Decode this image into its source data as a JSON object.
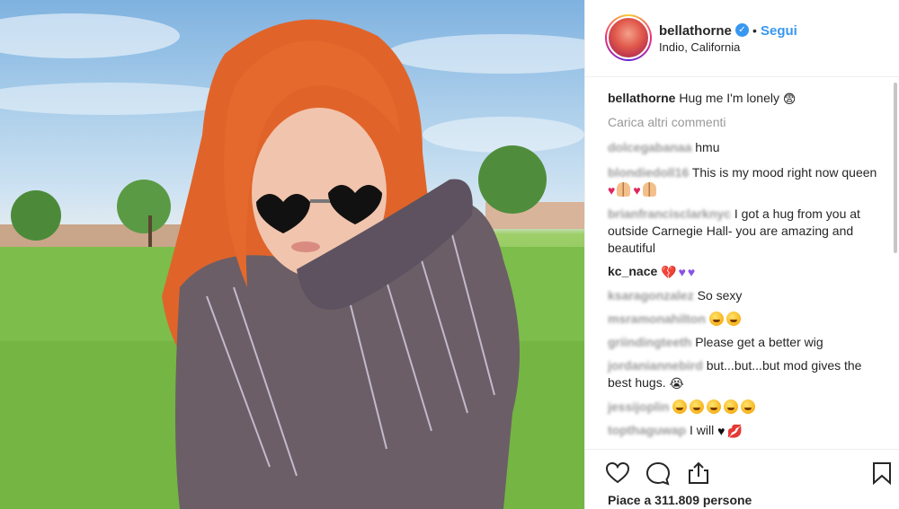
{
  "post": {
    "username": "bellathorne",
    "follow_label": "Segui",
    "separator": "•",
    "location": "Indio, California",
    "caption": "Hug me I'm lonely",
    "load_more": "Carica altri commenti",
    "likes_text": "Piace a 311.809 persone"
  },
  "comments": [
    {
      "user": "dolcegabanaa",
      "text": "hmu",
      "emojis": []
    },
    {
      "user": "blondiedoll16",
      "text": "This is my mood right now queen",
      "emojis": [
        "red-heart",
        "pray",
        "red-heart",
        "pray"
      ]
    },
    {
      "user": "brianfrancisclarknyc",
      "text": "I got a hug from you at outside Carnegie Hall- you are amazing and beautiful",
      "emojis": []
    },
    {
      "user": "kc_nace",
      "text": "",
      "emojis": [
        "broken-heart",
        "purple-heart",
        "purple-heart"
      ]
    },
    {
      "user": "ksaragonzalez",
      "text": "So sexy",
      "emojis": []
    },
    {
      "user": "msramonahilton",
      "text": "",
      "emojis": [
        "smile",
        "smile"
      ]
    },
    {
      "user": "griindingteeth",
      "text": "Please get a better wig",
      "emojis": []
    },
    {
      "user": "jordaniannebird",
      "text": "but...but...but mod gives the best hugs.",
      "emojis": [
        "crying-face"
      ]
    },
    {
      "user": "jessijoplin",
      "text": "",
      "emojis": [
        "smile",
        "smile",
        "smile",
        "smile",
        "smile"
      ]
    },
    {
      "user": "topthaguwap",
      "text": "I will",
      "emojis": [
        "black-heart",
        "lips"
      ]
    }
  ],
  "icons": {
    "like": "heart-outline-icon",
    "comment": "comment-bubble-icon",
    "share": "share-upload-icon",
    "save": "bookmark-icon"
  },
  "colors": {
    "accent": "#3897f0",
    "muted": "#999999",
    "text": "#262626"
  }
}
